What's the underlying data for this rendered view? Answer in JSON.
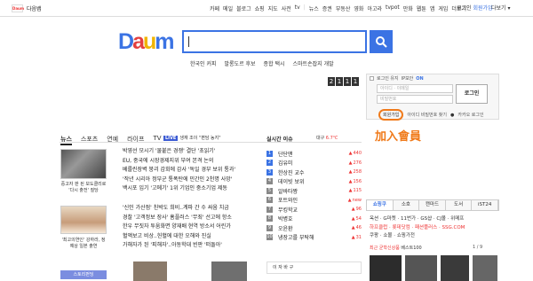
{
  "topbar": {
    "logo_text": "Daum",
    "site_name": "다음뱁",
    "nav": [
      "카페",
      "메일",
      "블로그",
      "쇼핑",
      "지도",
      "사전",
      "tv",
      "|",
      "뉴스",
      "증권",
      "부동산",
      "영화",
      "아고라",
      "tvpot",
      "만화",
      "웹툰",
      "앱",
      "게임",
      "더보기"
    ],
    "login_label": "로그인",
    "signup_label": "회원가입",
    "settings_label": "다보기 ▾"
  },
  "brand": {
    "logo_letters": [
      "D",
      "a",
      "u",
      "m"
    ],
    "logo_colors": [
      "#3b73e4",
      "#e33f3f",
      "#f0b400",
      "#3b73e4"
    ]
  },
  "search": {
    "value": ""
  },
  "trends": [
    "한국인 커피",
    "발롱도르 후보",
    "종합 택시",
    "스마트손잡지 개발"
  ],
  "clock": [
    "2",
    "1",
    "1",
    "1"
  ],
  "login_box": {
    "keep_login": "로그인 유지",
    "ip_security": "IP보안",
    "ip_state": "ON",
    "id_placeholder": "아이디 · 이메일",
    "pw_placeholder": "비밀번호",
    "login_button": "로그인",
    "signup_link": "회원가입",
    "find_link": "아이디 비밀번호 찾기",
    "kakao_link": "카카오 로그인"
  },
  "annotation": "加入會員",
  "news": {
    "tabs": [
      "뉴스",
      "스포츠",
      "연예",
      "라이프",
      "TV"
    ],
    "live_badge": "LIVE",
    "live_text": "생재 조이 \"편담 농지\"",
    "thumb1_caption": "중고자 판 된 보도클리로 '다시 출전' 질당",
    "thumb2_caption": "'최고의연인' 강하라, 정예상 일본 출연",
    "story_tag": "스토리펀딩",
    "headlines_1": [
      "박영선 모시기 '물붙은 경쟁' 결단 '초읽기'",
      "EU, 중국에 시장경제지위 부여 본격 논의",
      "베를린장벽 붕괴 감회에 감사 '독일 경부 보위 통과'",
      "'작년 시리아 정부군 통폭탄에 민간인 2천명 사망'",
      "백시포 입기 '고메기' 1위 기업인 중소기업 제동"
    ],
    "headlines_2": [
      "'신인 가산점' 친박도 희비..계파 간 수 싸움 치금",
      "경찰 '고객정보 장사' 홈플러스 '무죄' 선고에 항소",
      "한우 무짓자 투움화면 양재배 현역 방소서 어린가",
      "혈액보고 비상..헌혈에 대한 오해와 진실",
      "가해자가 된 '피해자'..아동학대 빈판 '떠돌아'"
    ]
  },
  "realtime": {
    "title": "실시간 이슈",
    "weather_city": "대구",
    "weather_temp": "6.7℃",
    "items": [
      {
        "rank": "1",
        "word": "단단맨",
        "change": "440"
      },
      {
        "rank": "2",
        "word": "김유미",
        "change": "276"
      },
      {
        "rank": "3",
        "word": "한상진 교수",
        "change": "258"
      },
      {
        "rank": "4",
        "word": "데이빗 보위",
        "change": "156"
      },
      {
        "rank": "5",
        "word": "알바타짱",
        "change": "115"
      },
      {
        "rank": "6",
        "word": "포트와인",
        "change": "new"
      },
      {
        "rank": "7",
        "word": "무킹학교",
        "change": "96"
      },
      {
        "rank": "8",
        "word": "박병호",
        "change": "54"
      },
      {
        "rank": "9",
        "word": "오윤환",
        "change": "46"
      },
      {
        "rank": "10",
        "word": "냉장고를 부탁해",
        "change": "31"
      }
    ],
    "bottom_box": "이 자 바 구"
  },
  "shopping": {
    "tabs": [
      "쇼핑쿠",
      "소호",
      "캔마드",
      "도서",
      "iST24"
    ],
    "lines": [
      "옥션 · G마켓 · 11번가 · GS샵 · CJ몰 · 위메프",
      "하프클럽 · 롯데닷컴 · 패션플러스 · SSG.COM",
      "쿠팡 · 쇼몰 · 쇼핑가전"
    ],
    "new_label": "최근 균학신상품",
    "new_sub": "베스트100",
    "page": "1 / 9"
  }
}
